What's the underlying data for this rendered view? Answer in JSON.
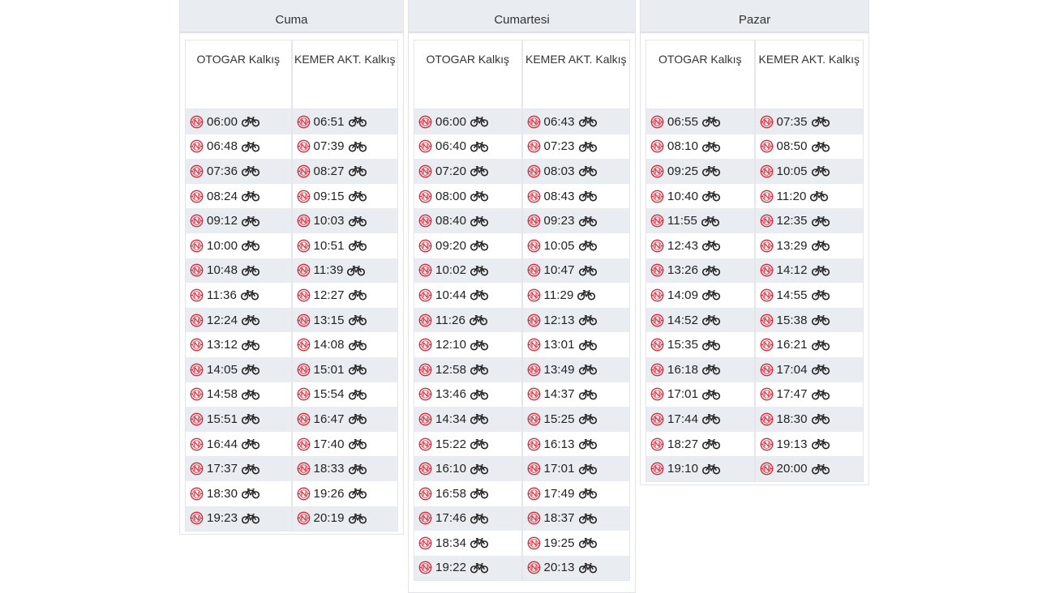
{
  "colors": {
    "logo": "#d62a3a",
    "header_bg": "#e9ecf0",
    "row_alt": "#e9ecf1"
  },
  "icons": {
    "operator": "bus-operator-logo-icon",
    "bike": "bicycle-icon"
  },
  "days": [
    {
      "title": "Cuma",
      "col1": "OTOGAR Kalkış",
      "col2": "KEMER AKT. Kalkış",
      "rows": [
        [
          "06:00",
          "06:51"
        ],
        [
          "06:48",
          "07:39"
        ],
        [
          "07:36",
          "08:27"
        ],
        [
          "08:24",
          "09:15"
        ],
        [
          "09:12",
          "10:03"
        ],
        [
          "10:00",
          "10:51"
        ],
        [
          "10:48",
          "11:39"
        ],
        [
          "11:36",
          "12:27"
        ],
        [
          "12:24",
          "13:15"
        ],
        [
          "13:12",
          "14:08"
        ],
        [
          "14:05",
          "15:01"
        ],
        [
          "14:58",
          "15:54"
        ],
        [
          "15:51",
          "16:47"
        ],
        [
          "16:44",
          "17:40"
        ],
        [
          "17:37",
          "18:33"
        ],
        [
          "18:30",
          "19:26"
        ],
        [
          "19:23",
          "20:19"
        ]
      ]
    },
    {
      "title": "Cumartesi",
      "col1": "OTOGAR Kalkış",
      "col2": "KEMER AKT. Kalkış",
      "rows": [
        [
          "06:00",
          "06:43"
        ],
        [
          "06:40",
          "07:23"
        ],
        [
          "07:20",
          "08:03"
        ],
        [
          "08:00",
          "08:43"
        ],
        [
          "08:40",
          "09:23"
        ],
        [
          "09:20",
          "10:05"
        ],
        [
          "10:02",
          "10:47"
        ],
        [
          "10:44",
          "11:29"
        ],
        [
          "11:26",
          "12:13"
        ],
        [
          "12:10",
          "13:01"
        ],
        [
          "12:58",
          "13:49"
        ],
        [
          "13:46",
          "14:37"
        ],
        [
          "14:34",
          "15:25"
        ],
        [
          "15:22",
          "16:13"
        ],
        [
          "16:10",
          "17:01"
        ],
        [
          "16:58",
          "17:49"
        ],
        [
          "17:46",
          "18:37"
        ],
        [
          "18:34",
          "19:25"
        ],
        [
          "19:22",
          "20:13"
        ]
      ]
    },
    {
      "title": "Pazar",
      "col1": "OTOGAR Kalkış",
      "col2": "KEMER AKT. Kalkış",
      "rows": [
        [
          "06:55",
          "07:35"
        ],
        [
          "08:10",
          "08:50"
        ],
        [
          "09:25",
          "10:05"
        ],
        [
          "10:40",
          "11:20"
        ],
        [
          "11:55",
          "12:35"
        ],
        [
          "12:43",
          "13:29"
        ],
        [
          "13:26",
          "14:12"
        ],
        [
          "14:09",
          "14:55"
        ],
        [
          "14:52",
          "15:38"
        ],
        [
          "15:35",
          "16:21"
        ],
        [
          "16:18",
          "17:04"
        ],
        [
          "17:01",
          "17:47"
        ],
        [
          "17:44",
          "18:30"
        ],
        [
          "18:27",
          "19:13"
        ],
        [
          "19:10",
          "20:00"
        ]
      ]
    }
  ]
}
